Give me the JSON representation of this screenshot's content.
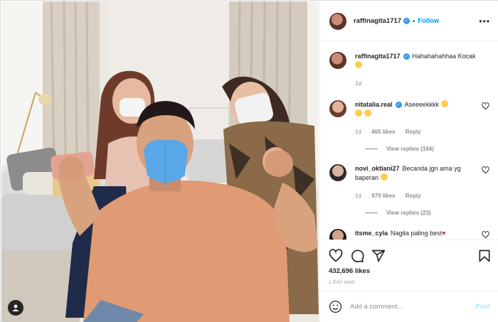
{
  "header": {
    "username": "raffinagita1717",
    "separator": "•",
    "follow_label": "Follow",
    "more_label": "•••"
  },
  "caption": {
    "username": "raffinagita1717",
    "text": "Hahahahahhaa Kocak",
    "time": "1d"
  },
  "comments": [
    {
      "username": "nitatalia.real",
      "text": "Aseeeekkkk",
      "time": "1d",
      "likes": "465 likes",
      "reply_label": "Reply",
      "view_replies": "View replies (164)"
    },
    {
      "username": "novi_oktiani27",
      "text": "Becanda jgn ama yg baperan",
      "time": "1d",
      "likes": "979 likes",
      "reply_label": "Reply",
      "view_replies": "View replies (23)"
    },
    {
      "username": "itsme_cyla",
      "text": "Nagita paling best"
    }
  ],
  "actions": {
    "likes": "432,696 likes",
    "time": "1 DAY AGO",
    "icons": [
      "heart-icon",
      "comment-icon",
      "share-icon",
      "bookmark-icon"
    ]
  },
  "add_comment": {
    "placeholder": "Add a comment...",
    "post_label": "Post"
  },
  "colors": {
    "accent": "#0095f6",
    "verified": "#3897f0",
    "muted": "#8e8e8e",
    "post_disabled": "#b2dffc"
  }
}
